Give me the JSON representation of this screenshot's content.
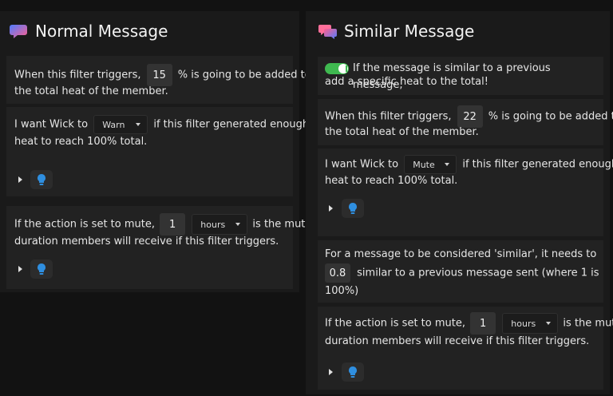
{
  "normal": {
    "title": "Normal Message",
    "icon": "chat-bubbles-icon",
    "heat_card": {
      "text_before": "When this filter triggers,",
      "value": "15",
      "text_after": "% is going to be added to",
      "text_line2": "the total heat of the member."
    },
    "action_card": {
      "text_before": "I want Wick to",
      "select_value": "Warn",
      "text_after": "if this filter generated enough",
      "text_line2": "heat to reach 100% total."
    },
    "mute_card": {
      "text_before": "If the action is set to mute,",
      "value": "1",
      "unit_value": "hours",
      "text_after": "is the mute",
      "text_line2": "duration members will receive if this filter triggers."
    }
  },
  "similar": {
    "title": "Similar Message",
    "icon": "chat-bubbles-icon",
    "toggle_card": {
      "enabled": true,
      "text_line1": "If the message is similar to a previous message,",
      "text_line2": "add a specific heat to the total!"
    },
    "heat_card": {
      "text_before": "When this filter triggers,",
      "value": "22",
      "text_after": "% is going to be added to",
      "text_line2": "the total heat of the member."
    },
    "action_card": {
      "text_before": "I want Wick to",
      "select_value": "Mute",
      "text_after": "if this filter generated enough",
      "text_line2": "heat to reach 100% total."
    },
    "similarity_card": {
      "text_line1": "For a message to be considered 'similar', it needs to be",
      "value": "0.8",
      "text_after": "similar to a previous message sent (where 1 is",
      "text_line3": "100%)"
    },
    "mute_card": {
      "text_before": "If the action is set to mute,",
      "value": "1",
      "unit_value": "hours",
      "text_after": "is the mute",
      "text_line2": "duration members will receive if this filter triggers."
    }
  },
  "colors": {
    "accent_toggle": "#3fb950",
    "bulb_blue": "#2f8fe0"
  }
}
